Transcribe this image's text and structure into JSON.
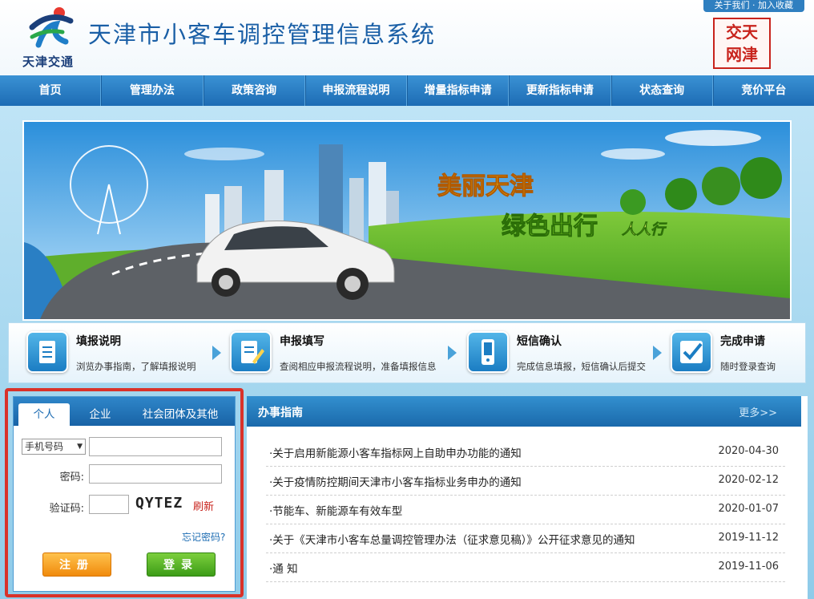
{
  "header": {
    "top_link": "关于我们 · 加入收藏",
    "logo_text": "天津交通",
    "site_title": "天津市小客车调控管理信息系统",
    "seal_text": [
      "交天",
      "网津"
    ]
  },
  "nav": {
    "items": [
      {
        "label": "首页"
      },
      {
        "label": "管理办法"
      },
      {
        "label": "政策咨询"
      },
      {
        "label": "申报流程说明"
      },
      {
        "label": "增量指标申请"
      },
      {
        "label": "更新指标申请"
      },
      {
        "label": "状态查询"
      },
      {
        "label": "竞价平台"
      }
    ]
  },
  "banner": {
    "headline": "美丽天津",
    "subline": "绿色出行",
    "subline_tag": "人人行"
  },
  "steps": [
    {
      "title": "填报说明",
      "desc": "浏览办事指南，了解填报说明",
      "icon": "document-icon"
    },
    {
      "title": "申报填写",
      "desc": "查阅相应申报流程说明，准备填报信息",
      "icon": "form-edit-icon"
    },
    {
      "title": "短信确认",
      "desc": "完成信息填报，短信确认后提交",
      "icon": "phone-icon"
    },
    {
      "title": "完成申请",
      "desc": "随时登录查询",
      "icon": "checkmark-icon"
    }
  ],
  "login": {
    "tabs": [
      {
        "label": "个人",
        "active": true
      },
      {
        "label": "企业",
        "active": false
      },
      {
        "label": "社会团体及其他",
        "active": false
      }
    ],
    "id_type_selected": "手机号码",
    "password_label": "密码:",
    "captcha_label": "验证码:",
    "captcha_text": "QYTEZ",
    "refresh_label": "刷新",
    "forgot_label": "忘记密码?",
    "register_label": "注册",
    "login_label": "登录"
  },
  "guide": {
    "title": "办事指南",
    "more": "更多>>",
    "items": [
      {
        "title": "·关于启用新能源小客车指标网上自助申办功能的通知",
        "date": "2020-04-30"
      },
      {
        "title": "·关于疫情防控期间天津市小客车指标业务申办的通知",
        "date": "2020-02-12"
      },
      {
        "title": "·节能车、新能源车有效车型",
        "date": "2020-01-07"
      },
      {
        "title": "·关于《天津市小客车总量调控管理办法（征求意见稿）》公开征求意见的通知",
        "date": "2019-11-12"
      },
      {
        "title": "·通 知",
        "date": "2019-11-06"
      }
    ]
  },
  "colors": {
    "brand_blue": "#1d6cb4",
    "highlight_red": "#d9322a",
    "register_orange": "#f08a0c",
    "login_green": "#3c9c17"
  }
}
